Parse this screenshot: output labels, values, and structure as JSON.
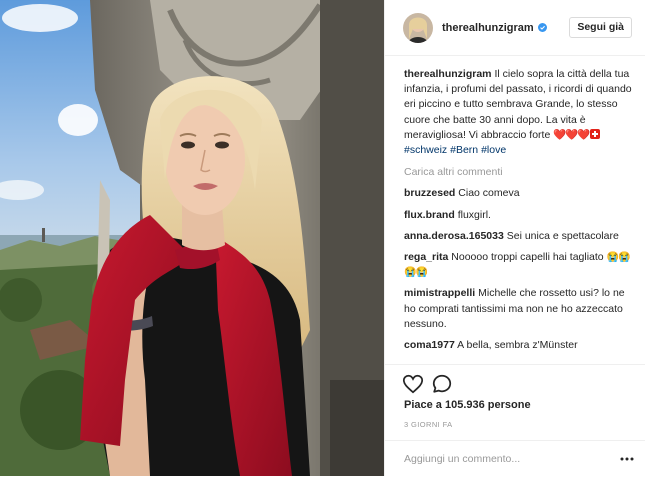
{
  "post": {
    "photo": {
      "icon": "photo",
      "colors": {
        "sky": "#6fa8e0",
        "stone": "#8e8a80",
        "scarf": "#b1122a",
        "hair": "#e8d3a4",
        "top": "#141414"
      }
    },
    "author": {
      "username": "therealhunzigram",
      "verified_icon": "verified-badge-icon",
      "follow_label": "Segui già"
    },
    "caption": {
      "username": "therealhunzigram",
      "text": "Il cielo sopra la città della tua infanzia, i profumi del passato, i ricordi di quando eri piccino e tutto sembrava Grande, lo stesso cuore che batte 30 anni dopo. La vita è meravigliosa! Vi abbraccio forte",
      "hearts": "❤️❤️❤️",
      "flag_icon": "swiss-flag-icon",
      "tags": [
        "#schweiz",
        "#Bern",
        "#love"
      ]
    },
    "load_more": "Carica altri commenti",
    "comments": [
      {
        "username": "bruzzesed",
        "text": "Ciao comeva"
      },
      {
        "username": "flux.brand",
        "text": "fluxgirl."
      },
      {
        "username": "anna.derosa.165033",
        "text": "Sei unica e spettacolare"
      },
      {
        "username": "rega_rita",
        "text": "Nooooo troppi capelli hai tagliato",
        "emoji": "😭😭😭😭"
      },
      {
        "username": "mimistrappelli",
        "text": "Michelle che rossetto usi? lo ne ho comprati tantissimi ma non ne ho azzeccato nessuno."
      },
      {
        "username": "coma1977",
        "text": "A bella, sembra z'Münster"
      }
    ],
    "actions": {
      "like_icon": "heart-icon",
      "comment_icon": "comment-icon",
      "likes_text": "Piace a 105.936 persone",
      "time_text": "3 GIORNI FA"
    },
    "add_comment": {
      "placeholder": "Aggiungi un commento...",
      "more_icon": "more-options-icon"
    }
  }
}
